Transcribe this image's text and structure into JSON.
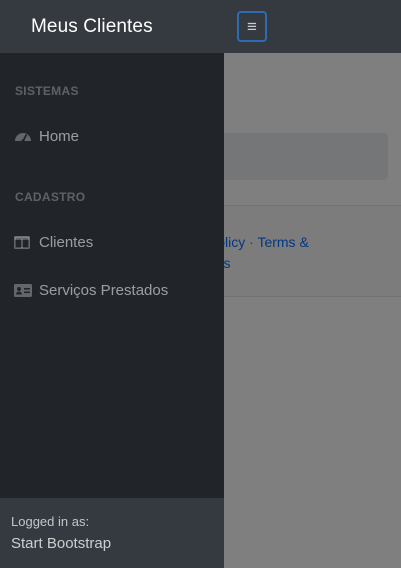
{
  "navbar": {
    "brand": "Meus Clientes",
    "toggle_icon": "≡"
  },
  "footer": {
    "link_privacy": "cy Policy",
    "separator": "·",
    "link_terms": "Terms &",
    "link_terms_cont": "ditions"
  },
  "sidebar": {
    "sections": [
      {
        "heading": "SISTEMAS",
        "items": [
          {
            "label": "Home",
            "icon": "tachometer-icon"
          }
        ]
      },
      {
        "heading": "CADASTRO",
        "items": [
          {
            "label": "Clientes",
            "icon": "table-columns-icon"
          },
          {
            "label": "Serviços Prestados",
            "icon": "id-card-icon"
          }
        ]
      }
    ],
    "footer": {
      "logged_in_label": "Logged in as:",
      "user": "Start Bootstrap"
    }
  }
}
